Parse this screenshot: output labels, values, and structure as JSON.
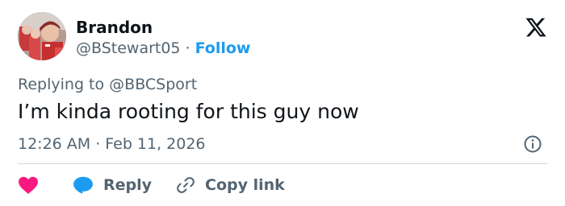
{
  "user": {
    "display_name": "Brandon",
    "handle": "@BStewart05",
    "separator": "·",
    "follow_label": "Follow"
  },
  "reply": {
    "prefix": "Replying to",
    "mention": "@BBCSport"
  },
  "tweet": {
    "text": "I’m kinda rooting for this guy now"
  },
  "meta": {
    "time": "12:26 AM",
    "separator": "·",
    "date": "Feb 11, 2026"
  },
  "actions": {
    "reply_label": "Reply",
    "copy_label": "Copy link"
  },
  "icons": {
    "logo": "x-logo-icon",
    "info": "info-icon",
    "like": "heart-icon",
    "reply": "chat-bubble-icon",
    "copy": "link-icon"
  },
  "colors": {
    "text": "#0f1419",
    "secondary": "#536471",
    "accent": "#1d9bf0",
    "heart": "#f91880",
    "divider": "#cfd9de"
  }
}
